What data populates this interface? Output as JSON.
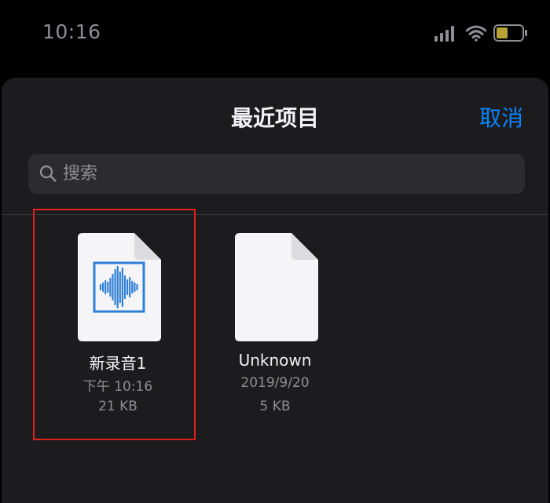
{
  "status_bar": {
    "time": "10:16"
  },
  "sheet": {
    "title": "最近项目",
    "cancel_label": "取消"
  },
  "search": {
    "placeholder": "搜索",
    "value": ""
  },
  "files": [
    {
      "name": "新录音1",
      "date": "下午 10:16",
      "size": "21 KB",
      "icon": "audio-waveform-icon"
    },
    {
      "name": "Unknown",
      "date": "2019/9/20",
      "size": "5 KB",
      "icon": "blank-document-icon"
    }
  ],
  "colors": {
    "accent": "#0a84ff",
    "sheet_background": "#1c1c1e",
    "highlight": "#e0201b",
    "waveform": "#2f7fd6"
  }
}
